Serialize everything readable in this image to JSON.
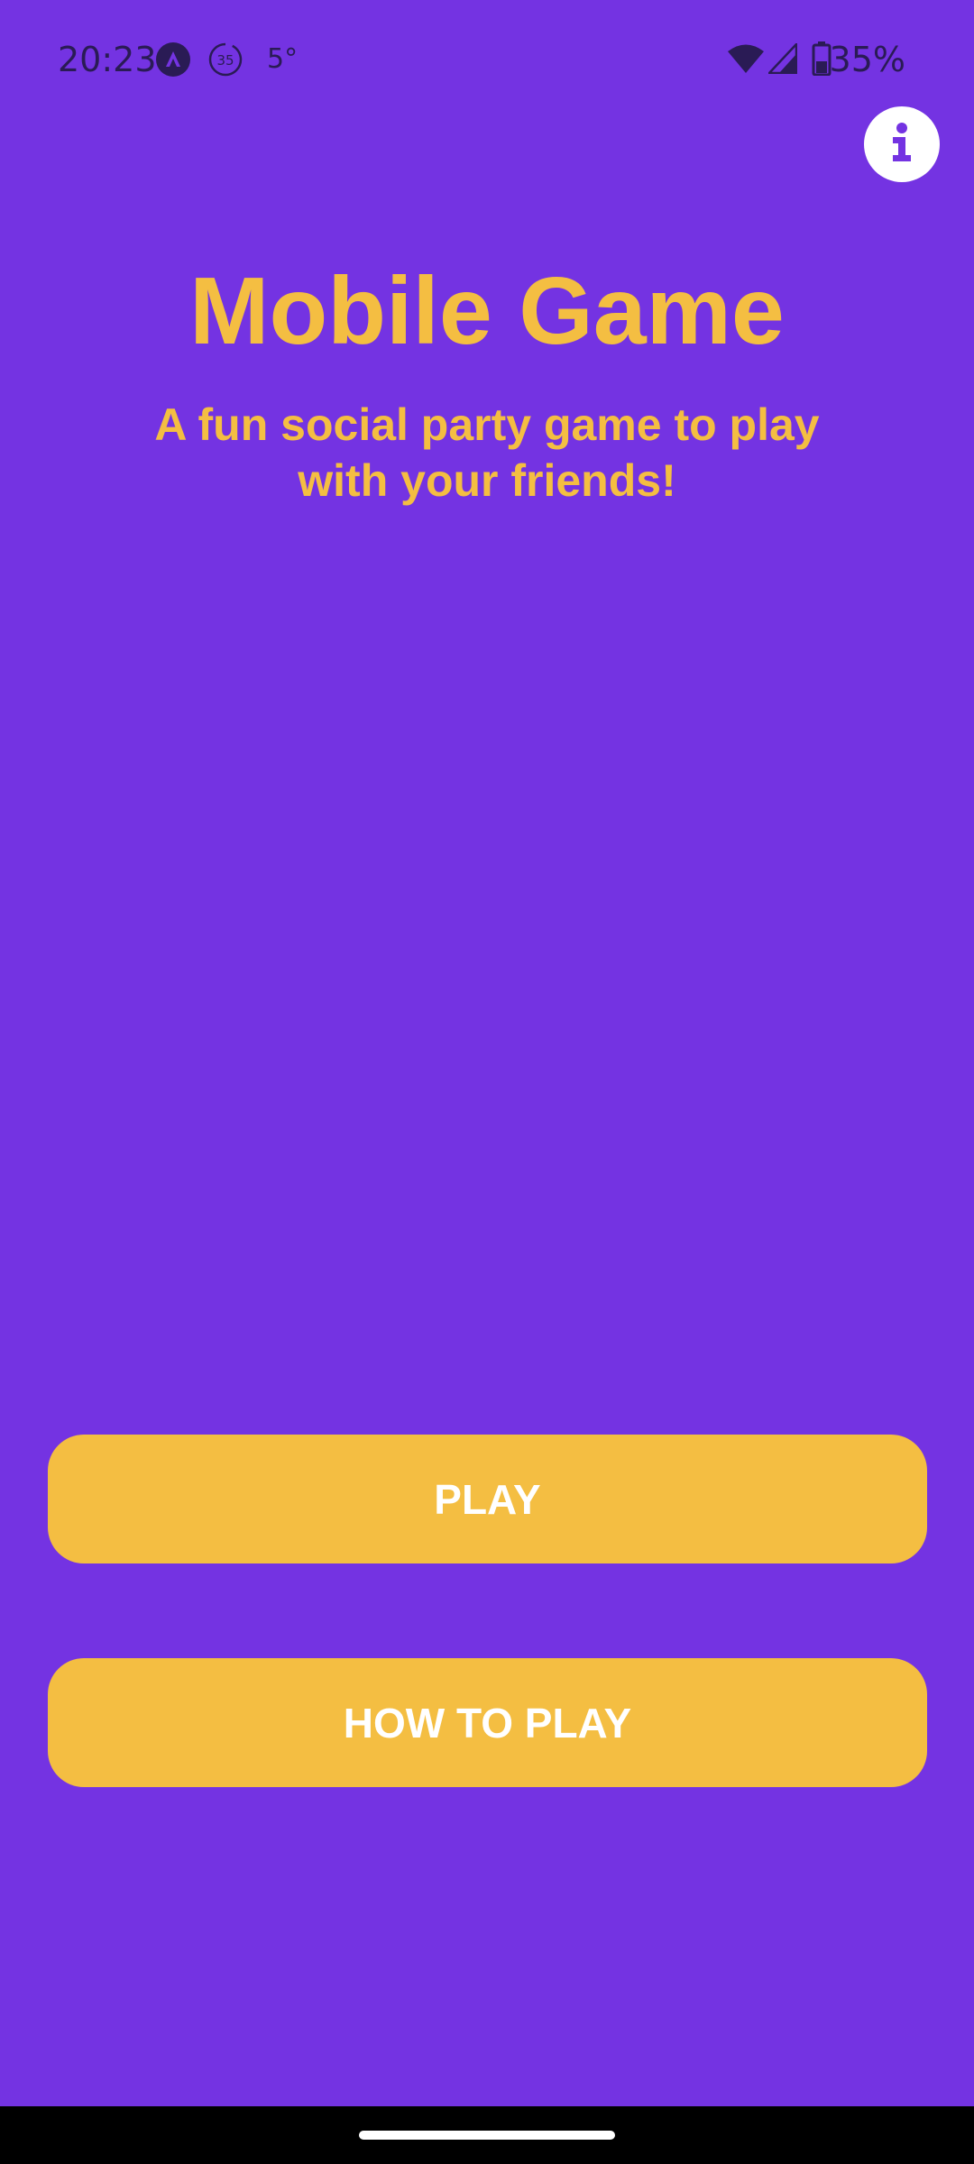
{
  "status_bar": {
    "time": "20:23",
    "temperature": "5°",
    "badge_number": "35",
    "battery": "35%",
    "icons": [
      "app-notification-icon",
      "timer-35-icon",
      "wifi-icon",
      "cell-signal-icon",
      "battery-icon"
    ]
  },
  "header": {
    "info_icon": "info-icon"
  },
  "main": {
    "title": "Mobile Game",
    "subtitle": "A fun social party game to play with your friends!"
  },
  "actions": {
    "play_label": "PLAY",
    "how_to_play_label": "HOW TO PLAY"
  },
  "colors": {
    "background": "#7433E2",
    "accent": "#F4BE42",
    "button_text": "#FFFFFF",
    "status_icons": "#2A1B55",
    "nav_bar": "#000000"
  }
}
